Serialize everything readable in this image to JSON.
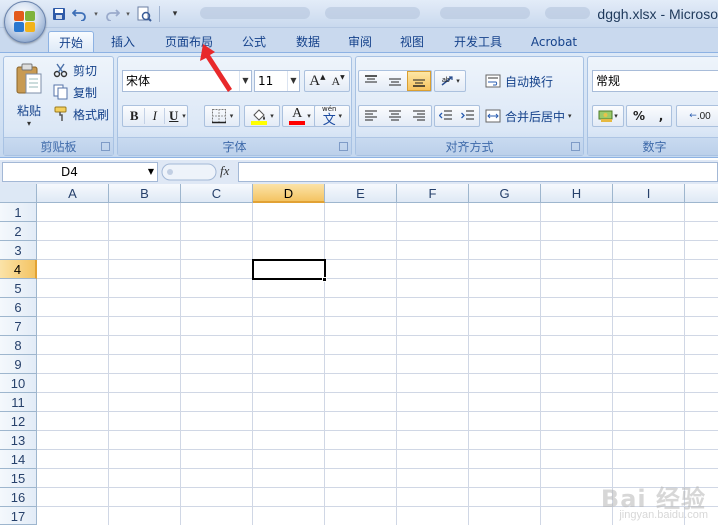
{
  "window": {
    "title": "dggh.xlsx - Microso",
    "quick_access": [
      "save-icon",
      "undo-icon",
      "redo-icon",
      "print-preview-icon",
      "customize-dropdown-icon"
    ]
  },
  "tabs": [
    {
      "label": "开始",
      "active": true
    },
    {
      "label": "插入",
      "active": false
    },
    {
      "label": "页面布局",
      "active": false
    },
    {
      "label": "公式",
      "active": false
    },
    {
      "label": "数据",
      "active": false
    },
    {
      "label": "审阅",
      "active": false
    },
    {
      "label": "视图",
      "active": false
    },
    {
      "label": "开发工具",
      "active": false
    },
    {
      "label": "Acrobat",
      "active": false
    }
  ],
  "ribbon": {
    "clipboard": {
      "group_label": "剪贴板",
      "paste": "粘贴",
      "cut": "剪切",
      "copy": "复制",
      "format_painter": "格式刷"
    },
    "font": {
      "group_label": "字体",
      "font_name": "宋体",
      "font_size": "11",
      "bold": "B",
      "italic": "I",
      "underline": "U",
      "grow": "A",
      "shrink": "A",
      "font_color": "A",
      "wen": "wén",
      "wen_char": "文"
    },
    "alignment": {
      "group_label": "对齐方式",
      "wrap_text": "自动换行",
      "merge_center": "合并后居中"
    },
    "number": {
      "group_label": "数字",
      "format": "常规",
      "percent": "%",
      "comma": ",",
      "inc_decimal": ".00"
    }
  },
  "formula_bar": {
    "name_box": "D4",
    "fx": "fx",
    "formula": ""
  },
  "sheet": {
    "columns": [
      "A",
      "B",
      "C",
      "D",
      "E",
      "F",
      "G",
      "H",
      "I"
    ],
    "rows": [
      "1",
      "2",
      "3",
      "4",
      "5",
      "6",
      "7",
      "8",
      "9",
      "10",
      "11",
      "12",
      "13",
      "14",
      "15",
      "16",
      "17"
    ],
    "selected_column": "D",
    "selected_row": "4"
  },
  "watermark": {
    "text": "Bai 经验",
    "url": "jingyan.baidu.com"
  },
  "colors": {
    "accent": "#15428b",
    "selection": "#f4c463",
    "annotation_arrow": "#e8292b"
  }
}
